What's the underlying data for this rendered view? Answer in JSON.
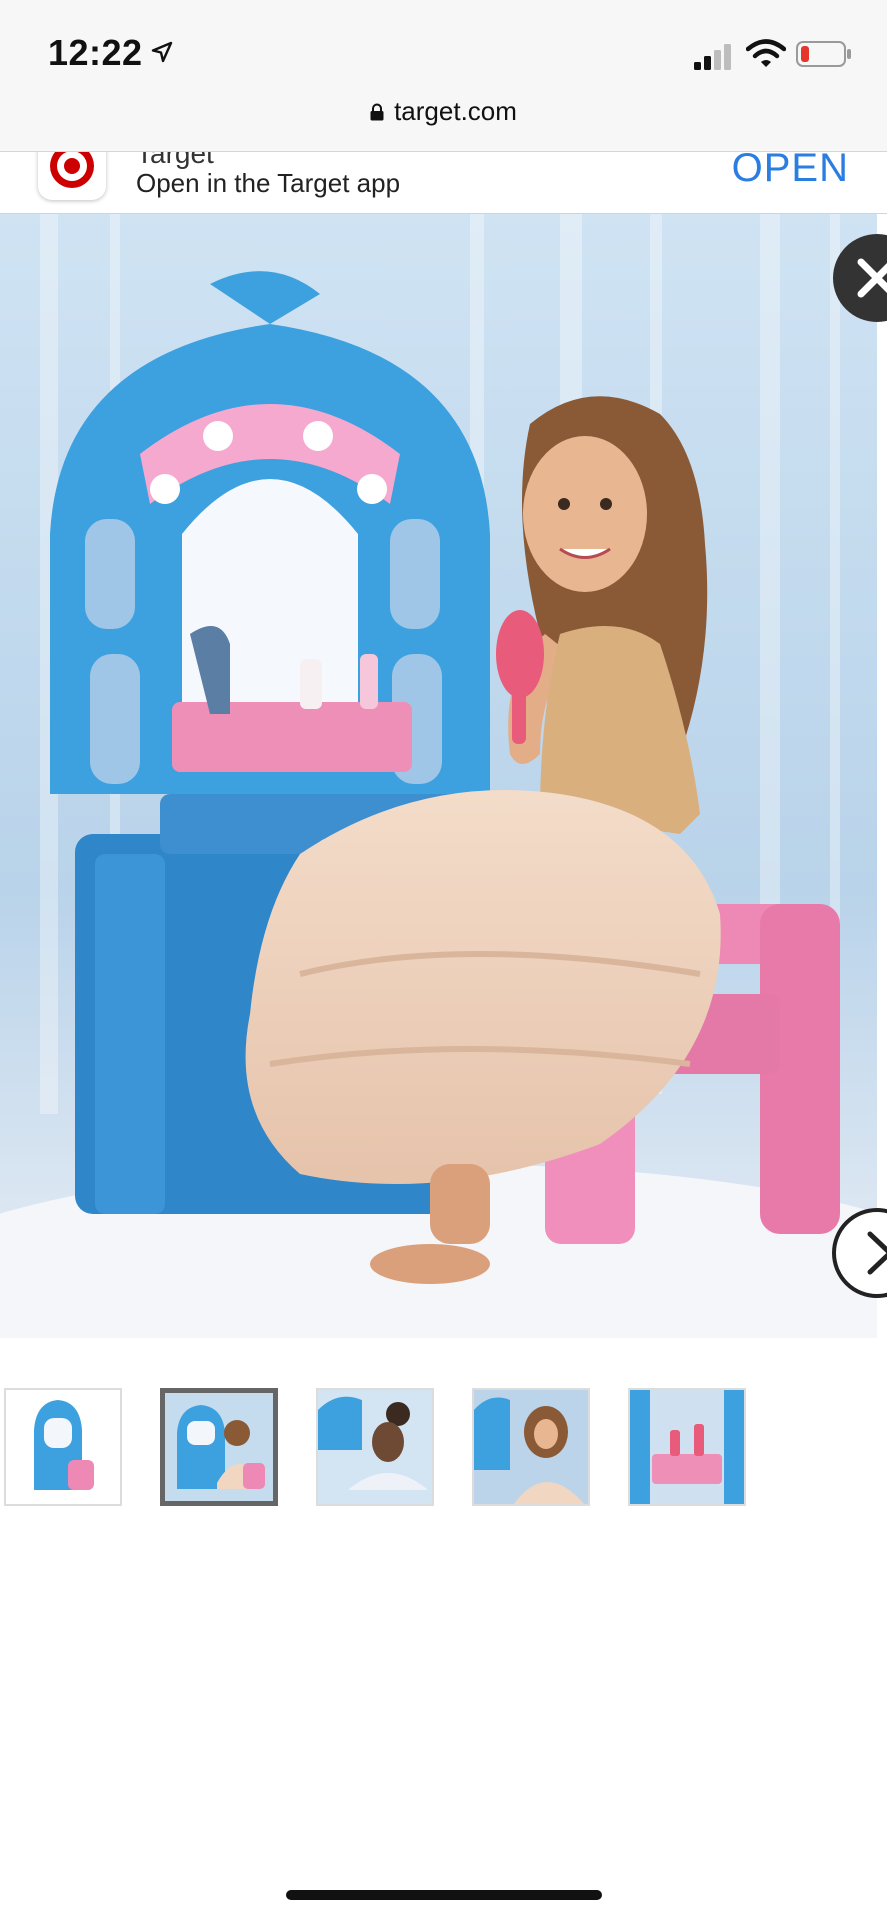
{
  "status_bar": {
    "time": "12:22",
    "icons": [
      "location-arrow-icon",
      "cellular-signal-icon",
      "wifi-icon",
      "battery-low-icon"
    ],
    "battery_color": "#e5362b"
  },
  "browser": {
    "url": "target.com",
    "lock_icon": "lock-icon"
  },
  "app_banner": {
    "app_name": "Target",
    "subtitle": "Open in the Target app",
    "open_label": "OPEN",
    "accent_color": "#2a7de1",
    "brand_color": "#cc0000"
  },
  "gallery": {
    "hero_alt": "Girl seated at a blue toy vanity with a pink stool",
    "close_icon": "close-icon",
    "next_icon": "chevron-right-icon",
    "thumbnails": [
      {
        "selected": false
      },
      {
        "selected": true
      },
      {
        "selected": false
      },
      {
        "selected": false
      },
      {
        "selected": false
      }
    ]
  }
}
